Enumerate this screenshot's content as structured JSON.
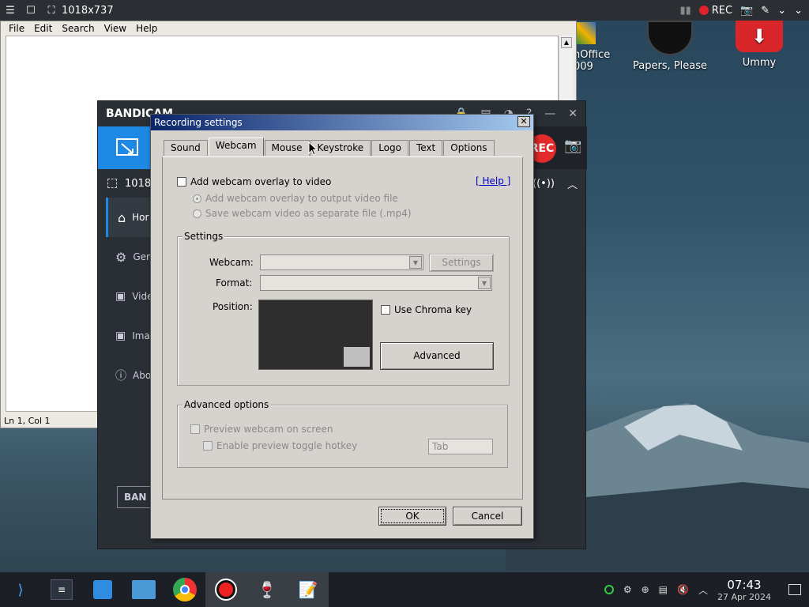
{
  "topbar": {
    "title": "1018x737",
    "rec_label": "REC"
  },
  "desktop": {
    "icons": [
      {
        "label": "nOffice",
        "sub": "009"
      },
      {
        "label": "Papers, Please"
      },
      {
        "label": "Ummy"
      }
    ]
  },
  "notepad": {
    "menu": [
      "File",
      "Edit",
      "Search",
      "View",
      "Help"
    ],
    "status": "Ln 1, Col 1"
  },
  "bandicam": {
    "logo": "BANDICAM",
    "size_label": "1018x",
    "rec_label": "REC",
    "sidebar": [
      "Hor",
      "Gen",
      "Vide",
      "Ima",
      "Abo"
    ],
    "bottom_logo": "BAN"
  },
  "dialog": {
    "title": "Recording settings",
    "tabs": [
      "Sound",
      "Webcam",
      "Mouse",
      "Keystroke",
      "Logo",
      "Text",
      "Options"
    ],
    "active_tab": "Webcam",
    "add_overlay_label": "Add webcam overlay to video",
    "help_label": "[ Help ]",
    "radio_output": "Add webcam overlay to output video file",
    "radio_separate": "Save webcam video as separate file (.mp4)",
    "settings_group": "Settings",
    "webcam_label": "Webcam:",
    "format_label": "Format:",
    "position_label": "Position:",
    "settings_button": "Settings",
    "chroma_label": "Use Chroma key",
    "advanced_button": "Advanced",
    "advanced_group": "Advanced options",
    "preview_label": "Preview webcam on screen",
    "toggle_label": "Enable preview toggle hotkey",
    "hotkey_value": "Tab",
    "ok_label": "OK",
    "cancel_label": "Cancel"
  },
  "taskbar": {
    "time": "07:43",
    "date": "27 Apr 2024"
  }
}
